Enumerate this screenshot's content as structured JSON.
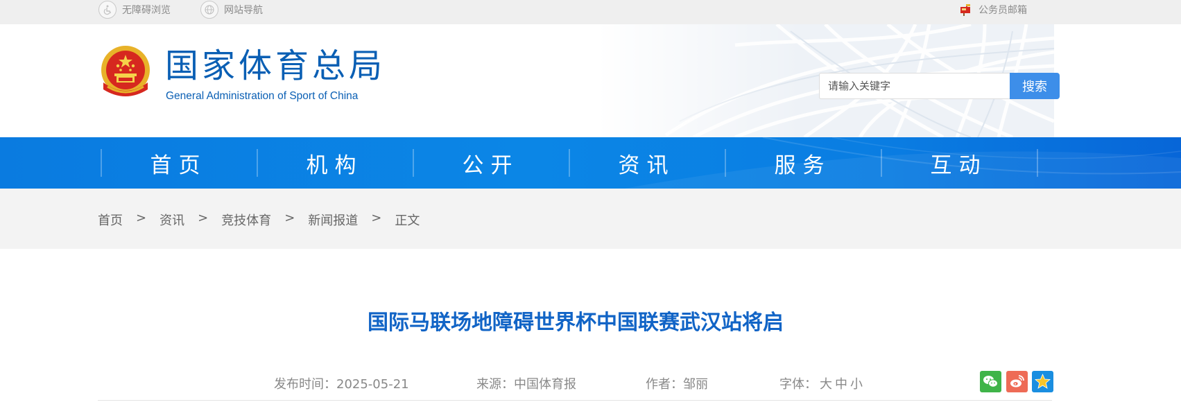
{
  "topbar": {
    "accessibility": "无障碍浏览",
    "sitemap": "网站导航",
    "mail": "公务员邮箱"
  },
  "header": {
    "title_cn": "国家体育总局",
    "title_en": "General Administration of Sport of China",
    "search_placeholder": "请输入关键字",
    "search_button": "搜索"
  },
  "nav": {
    "items": [
      {
        "label": "首页"
      },
      {
        "label": "机构"
      },
      {
        "label": "公开"
      },
      {
        "label": "资讯"
      },
      {
        "label": "服务"
      },
      {
        "label": "互动"
      }
    ]
  },
  "breadcrumb": {
    "items": [
      "首页",
      "资讯",
      "竞技体育",
      "新闻报道",
      "正文"
    ],
    "separator": ">"
  },
  "article": {
    "title": "国际马联场地障碍世界杯中国联赛武汉站将启",
    "date_label": "发布时间：",
    "date": "2025-05-21",
    "source_label": "来源：",
    "source": "中国体育报",
    "author_label": "作者：",
    "author": "邹丽",
    "font_label": "字体：",
    "font_large": "大",
    "font_medium": "中",
    "font_small": "小"
  },
  "share": {
    "wechat": "wechat-icon",
    "weibo": "weibo-icon",
    "favorite": "star-icon"
  },
  "colors": {
    "brand_blue": "#0a5fb4",
    "nav_blue": "#0b86e6",
    "search_button": "#3d8ee9",
    "title_blue": "#1164c6"
  }
}
